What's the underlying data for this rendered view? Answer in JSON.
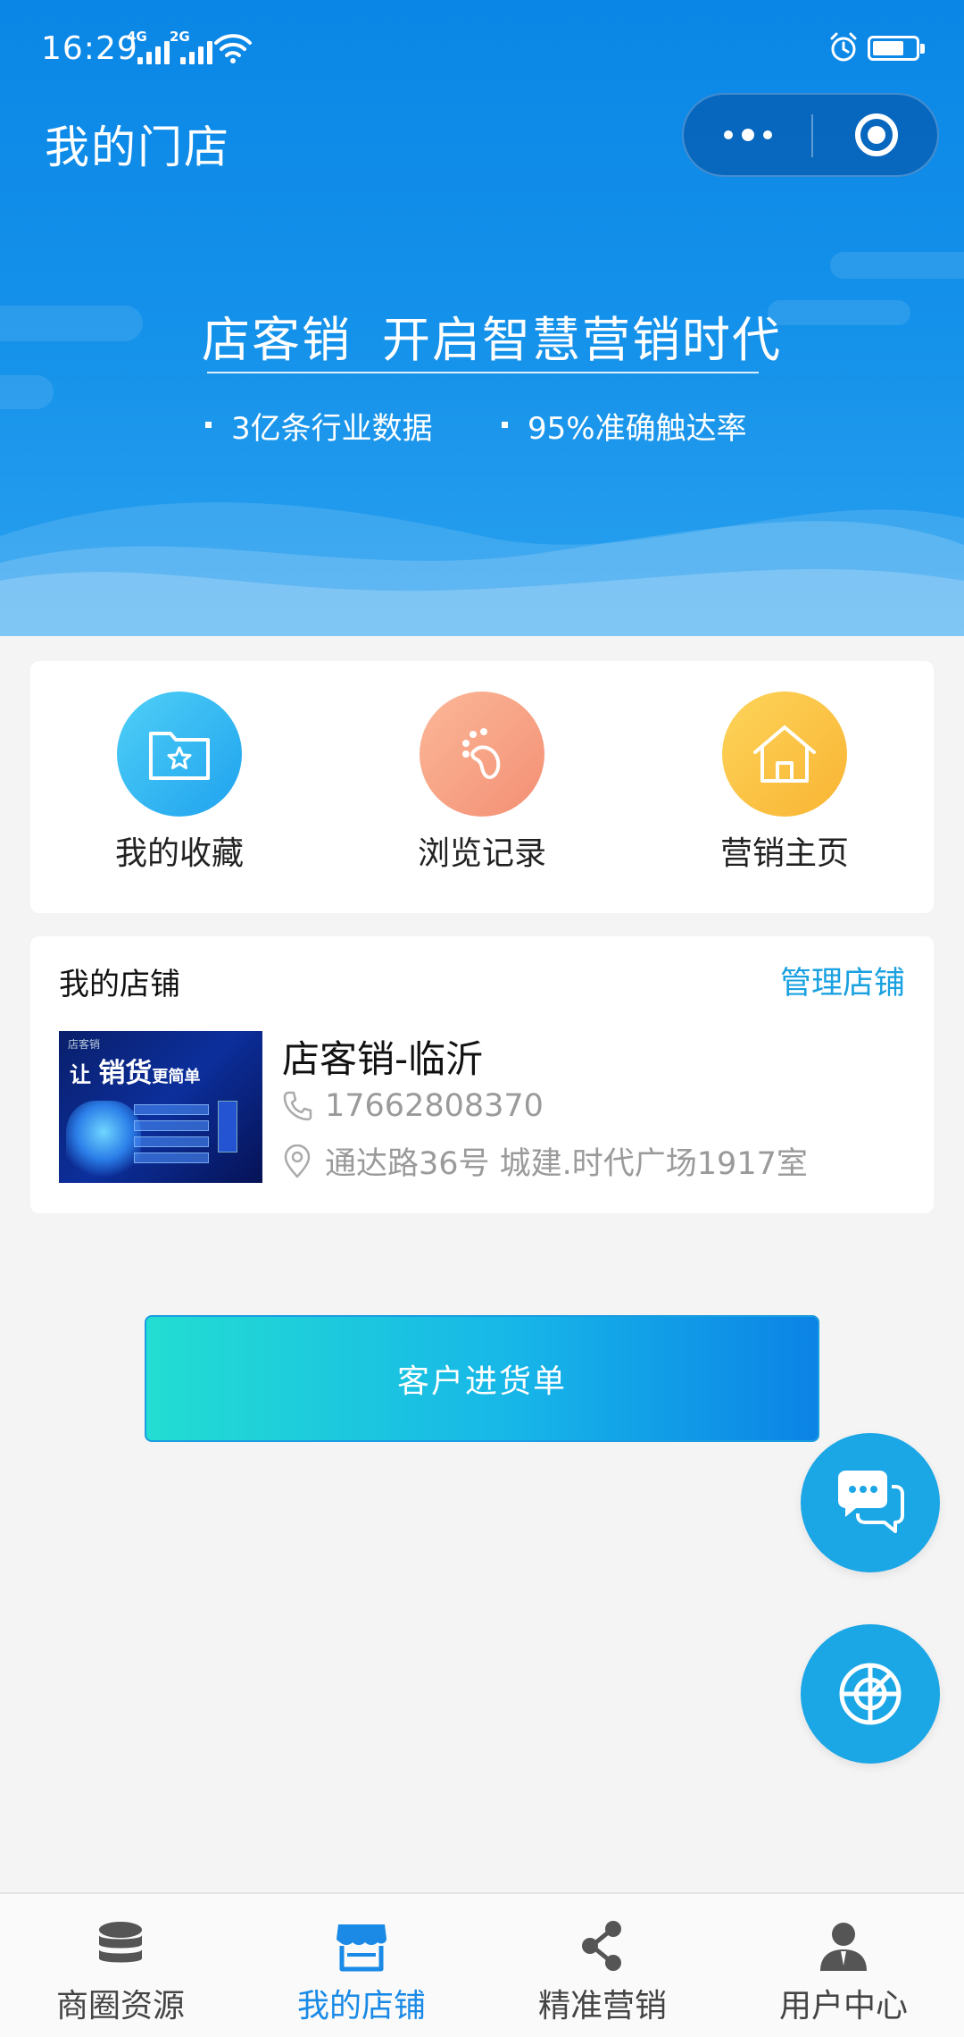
{
  "status_bar": {
    "time": "16:29",
    "signal1_label": "4G",
    "signal2_label": "2G",
    "battery_level": 0.65
  },
  "header": {
    "title": "我的门店"
  },
  "hero": {
    "slogan_left": "店客销",
    "slogan_right": "开启智慧营销时代",
    "features": [
      "3亿条行业数据",
      "95%准确触达率"
    ]
  },
  "quick_actions": [
    {
      "label": "我的收藏",
      "icon": "folder-star-icon",
      "color": "#2fb5f0"
    },
    {
      "label": "浏览记录",
      "icon": "footprint-icon",
      "color": "#f7a486"
    },
    {
      "label": "营销主页",
      "icon": "home-icon",
      "color": "#fcc444"
    }
  ],
  "store": {
    "section_title": "我的店铺",
    "manage_label": "管理店铺",
    "name": "店客销-临沂",
    "phone": "17662808370",
    "address": "通达路36号 城建.时代广场1917室",
    "thumb": {
      "brand": "店客销",
      "lead": "让",
      "headline": "销货",
      "tail": "更简单"
    }
  },
  "order_button": {
    "label": "客户进货单"
  },
  "fabs": [
    {
      "icon": "chat-icon"
    },
    {
      "icon": "radar-icon"
    }
  ],
  "tabbar": {
    "active_index": 1,
    "items": [
      {
        "label": "商圈资源",
        "icon": "database-icon"
      },
      {
        "label": "我的店铺",
        "icon": "shop-icon"
      },
      {
        "label": "精准营销",
        "icon": "share-icon"
      },
      {
        "label": "用户中心",
        "icon": "user-icon"
      }
    ]
  },
  "colors": {
    "brand_blue": "#0a86e6",
    "accent_link": "#1aa1e0",
    "fab": "#1ba6e6",
    "tab_active": "#1a8ae6"
  }
}
